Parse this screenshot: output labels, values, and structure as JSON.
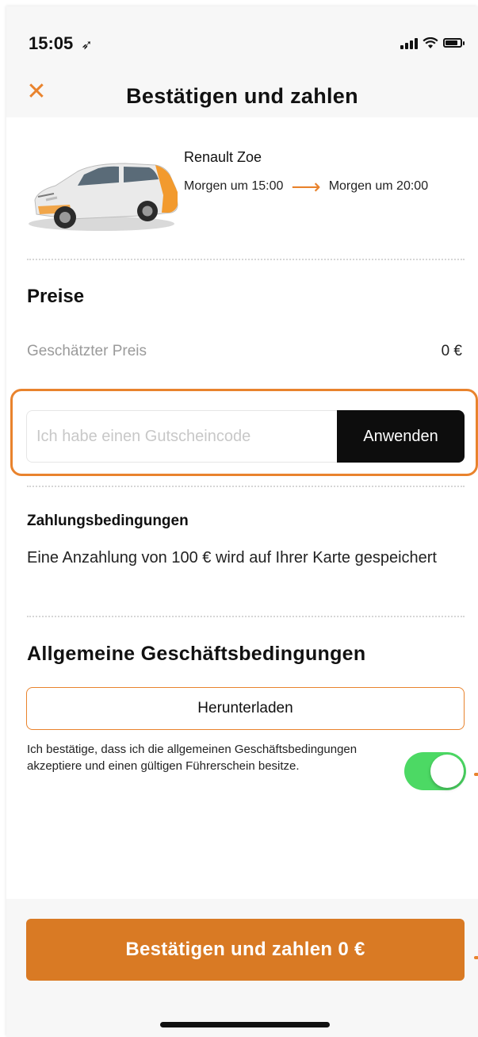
{
  "status_bar": {
    "time": "15:05",
    "location_icon": "location-arrow-icon",
    "signal_icon": "signal-bars-icon",
    "wifi_icon": "wifi-icon",
    "battery_icon": "battery-icon"
  },
  "header": {
    "close_icon": "close-icon",
    "title": "Bestätigen und zahlen"
  },
  "booking": {
    "car_image": "car-photo",
    "car_name": "Renault Zoe",
    "start": "Morgen um 15:00",
    "end": "Morgen um 20:00",
    "arrow_icon": "arrow-right-icon"
  },
  "prices": {
    "heading": "Preise",
    "estimated_label": "Geschätzter Preis",
    "estimated_value": "0 €"
  },
  "coupon": {
    "placeholder": "Ich habe einen Gutscheincode",
    "value": "",
    "apply_label": "Anwenden"
  },
  "payment_terms": {
    "heading": "Zahlungsbedingungen",
    "text": "Eine Anzahlung von 100 € wird auf Ihrer Karte gespeichert"
  },
  "terms": {
    "heading": "Allgemeine Geschäftsbedingungen",
    "download_label": "Herunterladen",
    "consent_text": "Ich bestätige, dass ich die allgemeinen Geschäftsbedingungen akzeptiere und einen gültigen Führerschein besitze.",
    "consent_checked": true
  },
  "footer": {
    "confirm_label": "Bestätigen und zahlen 0 €"
  },
  "colors": {
    "accent": "#e9832d",
    "confirm_button": "#d97a24",
    "toggle_on": "#4cd964",
    "apply_button": "#0d0d0d"
  }
}
